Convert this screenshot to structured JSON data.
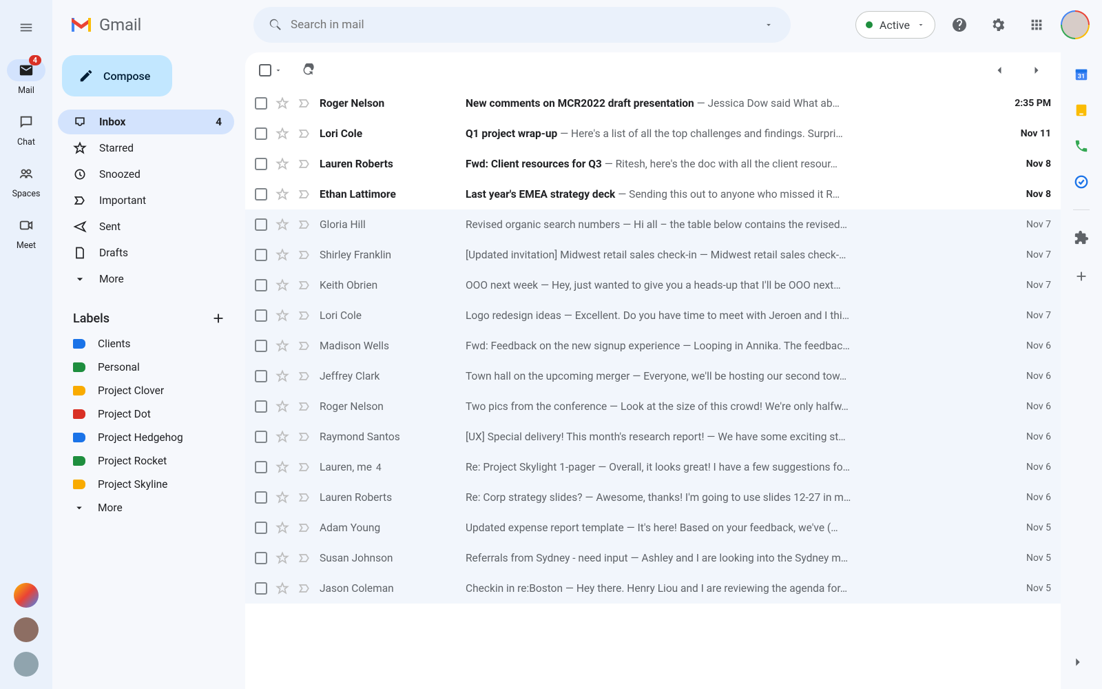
{
  "brand": "Gmail",
  "search": {
    "placeholder": "Search in mail"
  },
  "status": {
    "label": "Active",
    "color": "#1e8e3e"
  },
  "rail": {
    "items": [
      {
        "key": "mail",
        "label": "Mail",
        "badge": "4",
        "active": true
      },
      {
        "key": "chat",
        "label": "Chat"
      },
      {
        "key": "spaces",
        "label": "Spaces"
      },
      {
        "key": "meet",
        "label": "Meet"
      }
    ]
  },
  "compose_label": "Compose",
  "nav": [
    {
      "key": "inbox",
      "label": "Inbox",
      "count": "4",
      "active": true
    },
    {
      "key": "starred",
      "label": "Starred"
    },
    {
      "key": "snoozed",
      "label": "Snoozed"
    },
    {
      "key": "important",
      "label": "Important"
    },
    {
      "key": "sent",
      "label": "Sent"
    },
    {
      "key": "drafts",
      "label": "Drafts"
    },
    {
      "key": "more",
      "label": "More"
    }
  ],
  "labels_header": "Labels",
  "labels": [
    {
      "label": "Clients",
      "color": "#1a73e8"
    },
    {
      "label": "Personal",
      "color": "#1e8e3e"
    },
    {
      "label": "Project Clover",
      "color": "#f9ab00"
    },
    {
      "label": "Project Dot",
      "color": "#d93025"
    },
    {
      "label": "Project Hedgehog",
      "color": "#1a73e8"
    },
    {
      "label": "Project Rocket",
      "color": "#1e8e3e"
    },
    {
      "label": "Project Skyline",
      "color": "#f9ab00"
    }
  ],
  "labels_more": "More",
  "emails": [
    {
      "unread": true,
      "sender": "Roger Nelson",
      "subject": "New comments on MCR2022 draft presentation",
      "snippet": "Jessica Dow said What ab…",
      "date": "2:35 PM"
    },
    {
      "unread": true,
      "sender": "Lori Cole",
      "subject": "Q1 project wrap-up",
      "snippet": "Here's a list of all the top challenges and findings. Surpri…",
      "date": "Nov 11"
    },
    {
      "unread": true,
      "sender": "Lauren Roberts",
      "subject": "Fwd: Client resources for Q3",
      "snippet": "Ritesh, here's the doc with all the client resour…",
      "date": "Nov 8"
    },
    {
      "unread": true,
      "sender": "Ethan Lattimore",
      "subject": "Last year's EMEA strategy deck",
      "snippet": "Sending this out to anyone who missed it R…",
      "date": "Nov 8"
    },
    {
      "unread": false,
      "sender": "Gloria Hill",
      "subject": "Revised organic search numbers",
      "snippet": "Hi all – the table below contains the revised…",
      "date": "Nov 7"
    },
    {
      "unread": false,
      "sender": "Shirley Franklin",
      "subject": "[Updated invitation] Midwest retail sales check-in",
      "snippet": "Midwest retail sales check-…",
      "date": "Nov 7"
    },
    {
      "unread": false,
      "sender": "Keith Obrien",
      "subject": "OOO next week",
      "snippet": "Hey, just wanted to give you a heads-up that I'll be OOO next…",
      "date": "Nov 7"
    },
    {
      "unread": false,
      "sender": "Lori Cole",
      "subject": "Logo redesign ideas",
      "snippet": "Excellent. Do you have time to meet with Jeroen and I thi…",
      "date": "Nov 7"
    },
    {
      "unread": false,
      "sender": "Madison Wells",
      "subject": "Fwd: Feedback on the new signup experience",
      "snippet": "Looping in Annika. The feedbac…",
      "date": "Nov 6"
    },
    {
      "unread": false,
      "sender": "Jeffrey Clark",
      "subject": "Town hall on the upcoming merger",
      "snippet": "Everyone, we'll be hosting our second tow…",
      "date": "Nov 6"
    },
    {
      "unread": false,
      "sender": "Roger Nelson",
      "subject": "Two pics from the conference",
      "snippet": "Look at the size of this crowd! We're only halfw…",
      "date": "Nov 6"
    },
    {
      "unread": false,
      "sender": "Raymond Santos",
      "subject": "[UX] Special delivery! This month's research report!",
      "snippet": "We have some exciting st…",
      "date": "Nov 6"
    },
    {
      "unread": false,
      "sender": "Lauren, me",
      "thread_count": "4",
      "subject": "Re: Project Skylight 1-pager",
      "snippet": "Overall, it looks great! I have a few suggestions fo…",
      "date": "Nov 6"
    },
    {
      "unread": false,
      "sender": "Lauren Roberts",
      "subject": "Re: Corp strategy slides?",
      "snippet": "Awesome, thanks! I'm going to use slides 12-27 in m…",
      "date": "Nov 6"
    },
    {
      "unread": false,
      "sender": "Adam Young",
      "subject": "Updated expense report template",
      "snippet": "It's here! Based on your feedback, we've (…",
      "date": "Nov 5"
    },
    {
      "unread": false,
      "sender": "Susan Johnson",
      "subject": "Referrals from Sydney - need input",
      "snippet": "Ashley and I are looking into the Sydney m…",
      "date": "Nov 5"
    },
    {
      "unread": false,
      "sender": "Jason Coleman",
      "subject": "Checkin in re:Boston",
      "snippet": "Hey there. Henry Liou and I are reviewing the agenda for…",
      "date": "Nov 5"
    }
  ]
}
